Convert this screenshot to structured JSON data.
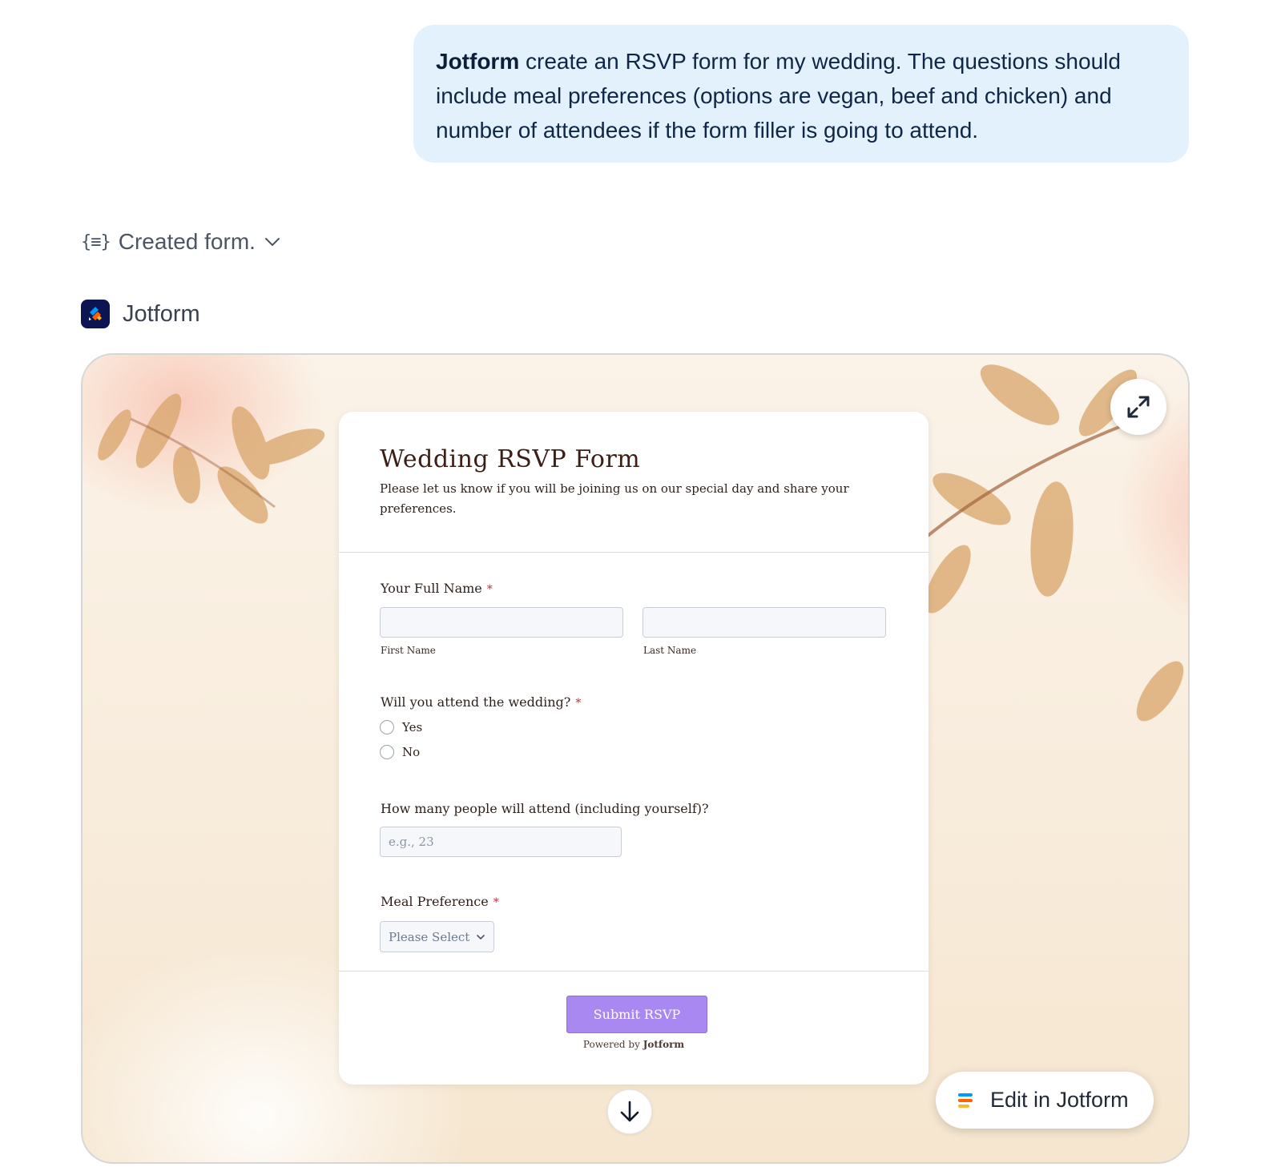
{
  "user_message": {
    "mention": "Jotform",
    "text": " create an RSVP form for my wedding. The questions should include meal preferences (options are vegan, beef and chicken) and number of attendees if the form filler is going to attend."
  },
  "tool_status": {
    "icon": "form-braces-icon",
    "label": "Created form."
  },
  "app": {
    "name": "Jotform",
    "brand_color": "#0a1551"
  },
  "form": {
    "title": "Wedding RSVP Form",
    "description": "Please let us know if you will be joining us on our special day and share your preferences.",
    "name_question": {
      "label": "Your Full Name",
      "required_mark": "*",
      "first_sublabel": "First Name",
      "last_sublabel": "Last Name"
    },
    "attend_question": {
      "label": "Will you attend the wedding?",
      "required_mark": "*",
      "options": [
        "Yes",
        "No"
      ]
    },
    "count_question": {
      "label": "How many people will attend (including yourself)?",
      "placeholder": "e.g., 23"
    },
    "meal_question": {
      "label": "Meal Preference",
      "required_mark": "*",
      "selected": "Please Select"
    },
    "submit_label": "Submit RSVP",
    "powered_prefix": "Powered by ",
    "powered_brand": "Jotform",
    "submit_color": "#a988f2"
  },
  "actions": {
    "edit_label": "Edit in Jotform",
    "expand_icon": "expand-icon",
    "scroll_icon": "arrow-down-icon"
  }
}
